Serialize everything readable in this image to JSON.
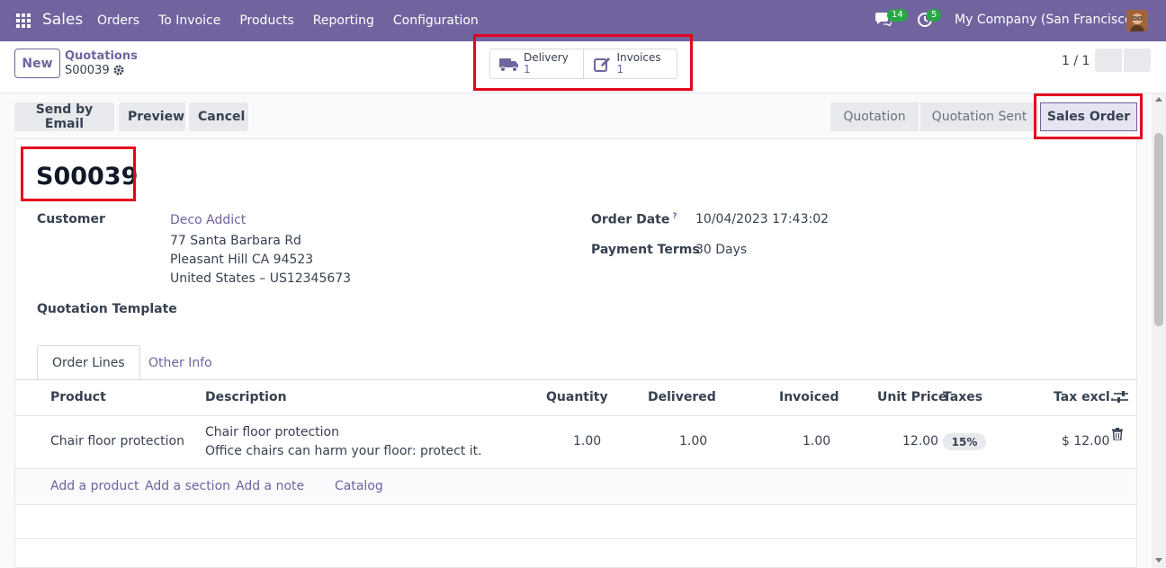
{
  "navbar": {
    "app_name": "Sales",
    "menu": [
      "Orders",
      "To Invoice",
      "Products",
      "Reporting",
      "Configuration"
    ],
    "messages_count": "14",
    "activities_count": "5",
    "company": "My Company (San Francisco)"
  },
  "control_panel": {
    "new_label": "New",
    "breadcrumb_parent": "Quotations",
    "breadcrumb_current": "S00039",
    "smart_buttons": [
      {
        "label": "Delivery",
        "count": "1",
        "icon": "truck-icon"
      },
      {
        "label": "Invoices",
        "count": "1",
        "icon": "pencil-square-icon"
      }
    ],
    "pager": "1 / 1"
  },
  "statusbar": {
    "actions": [
      "Send by Email",
      "Preview",
      "Cancel"
    ],
    "stages": [
      "Quotation",
      "Quotation Sent",
      "Sales Order"
    ],
    "active_stage": "Sales Order"
  },
  "record": {
    "name": "S00039",
    "customer_label": "Customer",
    "customer_name": "Deco Addict",
    "customer_address": [
      "77 Santa Barbara Rd",
      "Pleasant Hill CA 94523",
      "United States – US12345673"
    ],
    "template_label": "Quotation Template",
    "order_date_label": "Order Date",
    "order_date_help": "?",
    "order_date": "10/04/2023 17:43:02",
    "payment_terms_label": "Payment Terms",
    "payment_terms": "30 Days"
  },
  "tabs": [
    "Order Lines",
    "Other Info"
  ],
  "order_lines": {
    "columns": [
      "Product",
      "Description",
      "Quantity",
      "Delivered",
      "Invoiced",
      "Unit Price",
      "Taxes",
      "Tax excl."
    ],
    "rows": [
      {
        "product": "Chair floor protection",
        "description_1": "Chair floor protection",
        "description_2": "Office chairs can harm your floor: protect it.",
        "quantity": "1.00",
        "delivered": "1.00",
        "invoiced": "1.00",
        "unit_price": "12.00",
        "taxes": "15%",
        "subtotal": "$ 12.00"
      }
    ],
    "add_links": [
      "Add a product",
      "Add a section",
      "Add a note",
      "Catalog"
    ]
  },
  "colors": {
    "brand": "#71639e",
    "annotation": "#e4031f",
    "badge": "#28a745"
  }
}
